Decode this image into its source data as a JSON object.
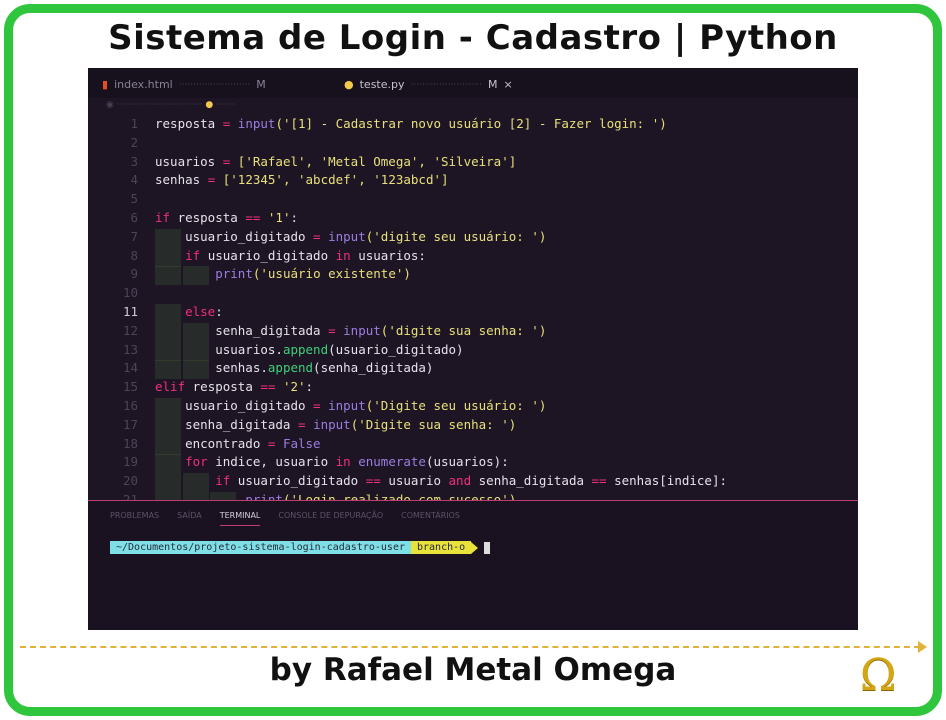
{
  "title": "Sistema de Login - Cadastro | Python",
  "byline": "by Rafael Metal Omega",
  "logo": "Ω",
  "colors": {
    "border": "#2fc63e",
    "accent": "#e0b23a",
    "editor_bg": "#1d1424"
  },
  "editor": {
    "tabs": [
      {
        "label": "index.html",
        "icon": "html-icon",
        "badge": "M"
      },
      {
        "label": "teste.py",
        "icon": "python-icon",
        "badge": "M",
        "close": "×"
      }
    ],
    "current_line": 11,
    "lines": [
      [
        [
          "resposta ",
          ""
        ],
        [
          "= ",
          "op"
        ],
        [
          "input",
          "fn"
        ],
        [
          "('[1] - Cadastrar novo usuário [2] - Fazer login: ')",
          "str"
        ]
      ],
      [],
      [
        [
          "usuarios ",
          ""
        ],
        [
          "= ",
          "op"
        ],
        [
          "['Rafael', 'Metal Omega', 'Silveira']",
          "str"
        ]
      ],
      [
        [
          "senhas ",
          ""
        ],
        [
          "= ",
          "op"
        ],
        [
          "['12345', 'abcdef', '123abcd']",
          "str"
        ]
      ],
      [],
      [
        [
          "if ",
          "kw"
        ],
        [
          "resposta ",
          ""
        ],
        [
          "== ",
          "op"
        ],
        [
          "'1'",
          "str"
        ],
        [
          ":",
          ""
        ]
      ],
      [
        [
          "    usuario_digitado ",
          ""
        ],
        [
          "= ",
          "op"
        ],
        [
          "input",
          "fn"
        ],
        [
          "('digite seu usuário: ')",
          "str"
        ]
      ],
      [
        [
          "    ",
          ""
        ],
        [
          "if ",
          "kw"
        ],
        [
          "usuario_digitado ",
          ""
        ],
        [
          "in ",
          "kw"
        ],
        [
          "usuarios:",
          ""
        ]
      ],
      [
        [
          "        ",
          ""
        ],
        [
          "print",
          "fn"
        ],
        [
          "('usuário existente')",
          "str"
        ]
      ],
      [],
      [
        [
          "    ",
          ""
        ],
        [
          "else",
          "kw"
        ],
        [
          ":",
          ""
        ]
      ],
      [
        [
          "        senha_digitada ",
          ""
        ],
        [
          "= ",
          "op"
        ],
        [
          "input",
          "fn"
        ],
        [
          "('digite sua senha: ')",
          "str"
        ]
      ],
      [
        [
          "        usuarios.",
          ""
        ],
        [
          "append",
          "meth"
        ],
        [
          "(usuario_digitado)",
          ""
        ]
      ],
      [
        [
          "        senhas.",
          ""
        ],
        [
          "append",
          "meth"
        ],
        [
          "(senha_digitada)",
          ""
        ]
      ],
      [
        [
          "elif ",
          "kw"
        ],
        [
          "resposta ",
          ""
        ],
        [
          "== ",
          "op"
        ],
        [
          "'2'",
          "str"
        ],
        [
          ":",
          ""
        ]
      ],
      [
        [
          "    usuario_digitado ",
          ""
        ],
        [
          "= ",
          "op"
        ],
        [
          "input",
          "fn"
        ],
        [
          "('Digite seu usuário: ')",
          "str"
        ]
      ],
      [
        [
          "    senha_digitada ",
          ""
        ],
        [
          "= ",
          "op"
        ],
        [
          "input",
          "fn"
        ],
        [
          "('Digite sua senha: ')",
          "str"
        ]
      ],
      [
        [
          "    encontrado ",
          ""
        ],
        [
          "= ",
          "op"
        ],
        [
          "False",
          "fn"
        ]
      ],
      [
        [
          "    ",
          ""
        ],
        [
          "for ",
          "kw"
        ],
        [
          "indice, usuario ",
          ""
        ],
        [
          "in ",
          "kw"
        ],
        [
          "enumerate",
          "fn"
        ],
        [
          "(usuarios):",
          ""
        ]
      ],
      [
        [
          "        ",
          ""
        ],
        [
          "if ",
          "kw"
        ],
        [
          "usuario_digitado ",
          ""
        ],
        [
          "== ",
          "op"
        ],
        [
          "usuario ",
          ""
        ],
        [
          "and ",
          "kw"
        ],
        [
          "senha_digitada ",
          ""
        ],
        [
          "== ",
          "op"
        ],
        [
          "senhas[indice]:",
          ""
        ]
      ],
      [
        [
          "            ",
          ""
        ],
        [
          "print",
          "fn"
        ],
        [
          "('Login realizado com sucesso')",
          "str"
        ]
      ]
    ]
  },
  "panel": {
    "tabs": [
      "PROBLEMAS",
      "SAÍDA",
      "TERMINAL",
      "CONSOLE DE DEPURAÇÃO",
      "COMENTÁRIOS"
    ],
    "active_tab": "TERMINAL",
    "prompt_path": "~/Documentos/projeto-sistema-login-cadastro-user",
    "prompt_branch": "branch-o"
  }
}
